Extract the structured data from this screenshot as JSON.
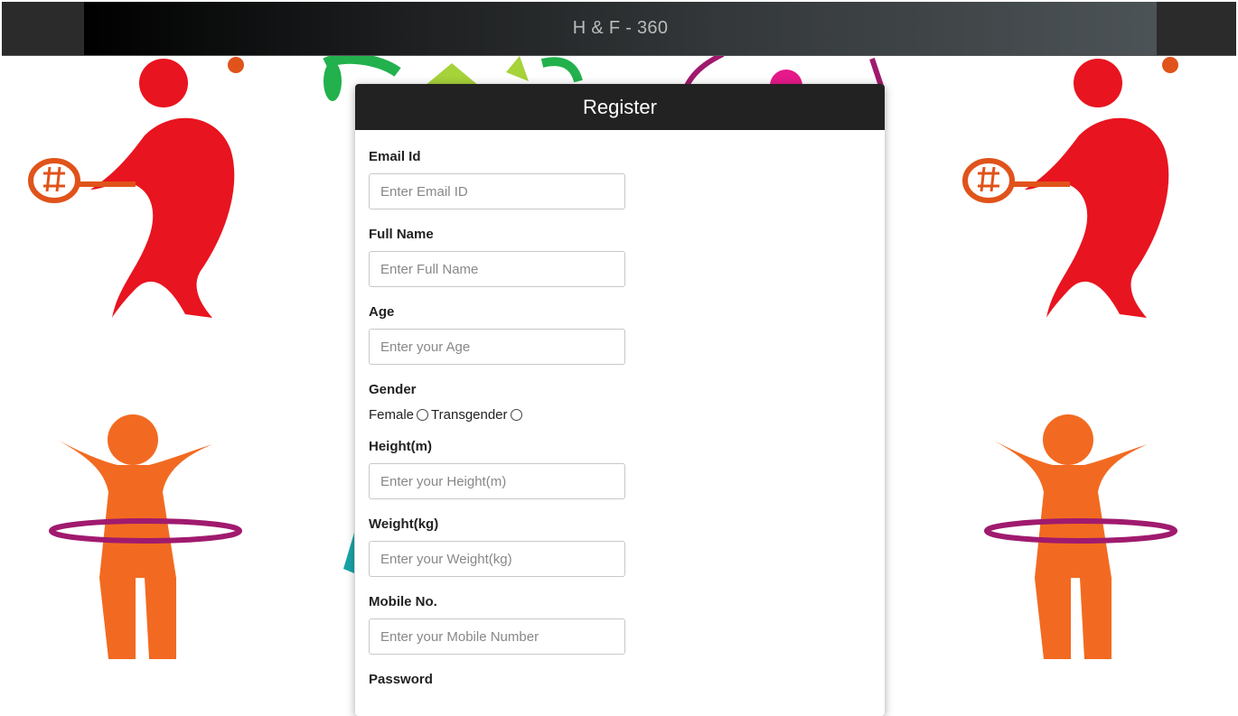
{
  "header": {
    "title": "H & F - 360"
  },
  "register": {
    "title": "Register",
    "fields": {
      "email": {
        "label": "Email Id",
        "placeholder": "Enter Email ID",
        "value": ""
      },
      "full_name": {
        "label": "Full Name",
        "placeholder": "Enter Full Name",
        "value": ""
      },
      "age": {
        "label": "Age",
        "placeholder": "Enter your Age",
        "value": ""
      },
      "height": {
        "label": "Height(m)",
        "placeholder": "Enter your Height(m)",
        "value": ""
      },
      "weight": {
        "label": "Weight(kg)",
        "placeholder": "Enter your Weight(kg)",
        "value": ""
      },
      "mobile": {
        "label": "Mobile No.",
        "placeholder": "Enter your Mobile Number",
        "value": ""
      },
      "password": {
        "label": "Password"
      }
    },
    "gender": {
      "label": "Gender",
      "options": [
        "Female",
        "Transgender"
      ]
    }
  },
  "colors": {
    "topbar": "#2b2b2b",
    "card_header": "#222222",
    "figure_red": "#e8141f",
    "figure_orange": "#f26a21",
    "hoop_purple": "#a01a6e"
  }
}
